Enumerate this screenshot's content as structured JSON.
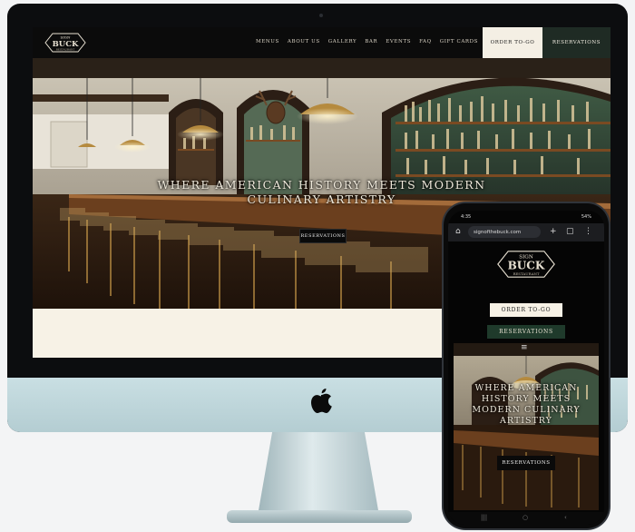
{
  "desktop": {
    "logo": {
      "top": "SIGN",
      "main": "BUCK",
      "sub": "OF THE",
      "bottom": "RESTAURANT"
    },
    "nav": [
      "MENUS",
      "ABOUT US",
      "GALLERY",
      "BAR",
      "EVENTS",
      "FAQ",
      "GIFT CARDS"
    ],
    "order_label": "ORDER TO-GO",
    "reservations_label": "RESERVATIONS",
    "hero_title_line1": "WHERE AMERICAN HISTORY MEETS MODERN",
    "hero_title_line2": "CULINARY ARTISTRY",
    "hero_button": "RESERVATIONS"
  },
  "phone": {
    "time": "4:35",
    "battery": "54%",
    "url": "signofthebuck.com",
    "order_label": "ORDER TO-GO",
    "reservations_label": "RESERVATIONS",
    "hero_title": [
      "WHERE AMERICAN",
      "HISTORY MEETS",
      "MODERN CULINARY",
      "ARTISTRY"
    ],
    "hero_button": "RESERVATIONS"
  },
  "colors": {
    "accent_green": "#1f2b24",
    "cream": "#f7f2e6",
    "brass": "#c99a48"
  }
}
